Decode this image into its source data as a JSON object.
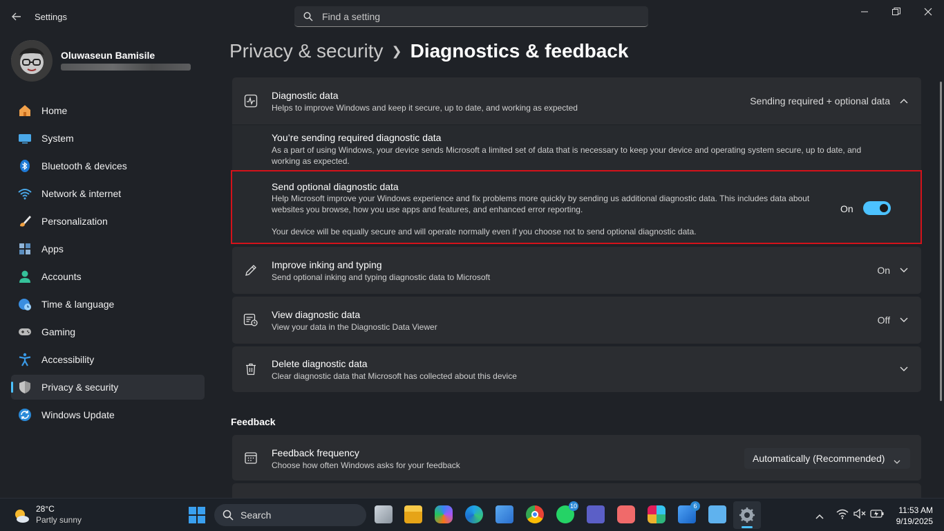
{
  "window": {
    "app_title": "Settings",
    "search_placeholder": "Find a setting"
  },
  "profile": {
    "name": "Oluwaseun Bamisile"
  },
  "sidebar": {
    "items": [
      {
        "label": "Home",
        "icon": "home-icon"
      },
      {
        "label": "System",
        "icon": "system-icon"
      },
      {
        "label": "Bluetooth & devices",
        "icon": "bluetooth-icon"
      },
      {
        "label": "Network & internet",
        "icon": "wifi-icon"
      },
      {
        "label": "Personalization",
        "icon": "brush-icon"
      },
      {
        "label": "Apps",
        "icon": "apps-icon"
      },
      {
        "label": "Accounts",
        "icon": "person-icon"
      },
      {
        "label": "Time & language",
        "icon": "globe-clock-icon"
      },
      {
        "label": "Gaming",
        "icon": "gamepad-icon"
      },
      {
        "label": "Accessibility",
        "icon": "accessibility-icon"
      },
      {
        "label": "Privacy & security",
        "icon": "shield-icon",
        "active": true
      },
      {
        "label": "Windows Update",
        "icon": "update-icon"
      }
    ]
  },
  "breadcrumb": {
    "parent": "Privacy & security",
    "current": "Diagnostics & feedback"
  },
  "diagnostic_data": {
    "title": "Diagnostic data",
    "desc": "Helps to improve Windows and keep it secure, up to date, and working as expected",
    "value": "Sending required + optional data",
    "required": {
      "title": "You’re sending required diagnostic data",
      "desc": "As a part of using Windows, your device sends Microsoft a limited set of data that is necessary to keep your device and operating system secure, up to date, and working as expected."
    },
    "optional": {
      "title": "Send optional diagnostic data",
      "desc": "Help Microsoft improve your Windows experience and fix problems more quickly by sending us additional diagnostic data. This includes data about websites you browse, how you use apps and features, and enhanced error reporting.",
      "note": "Your device will be equally secure and will operate normally even if you choose not to send optional diagnostic data.",
      "toggle_label": "On",
      "toggle_on": true
    }
  },
  "inking": {
    "title": "Improve inking and typing",
    "desc": "Send optional inking and typing diagnostic data to Microsoft",
    "value": "On"
  },
  "view_data": {
    "title": "View diagnostic data",
    "desc": "View your data in the Diagnostic Data Viewer",
    "value": "Off"
  },
  "delete_data": {
    "title": "Delete diagnostic data",
    "desc": "Clear diagnostic data that Microsoft has collected about this device"
  },
  "feedback": {
    "section_title": "Feedback",
    "frequency": {
      "title": "Feedback frequency",
      "desc": "Choose how often Windows asks for your feedback",
      "value": "Automatically (Recommended)"
    }
  },
  "taskbar": {
    "weather_temp": "28°C",
    "weather_desc": "Partly sunny",
    "search_label": "Search",
    "whatsapp_badge": "10",
    "app_badge": "6",
    "time": "11:53 AM",
    "date": "9/19/2025"
  },
  "colors": {
    "accent": "#4cc2ff",
    "highlight_border": "#d4121a"
  }
}
